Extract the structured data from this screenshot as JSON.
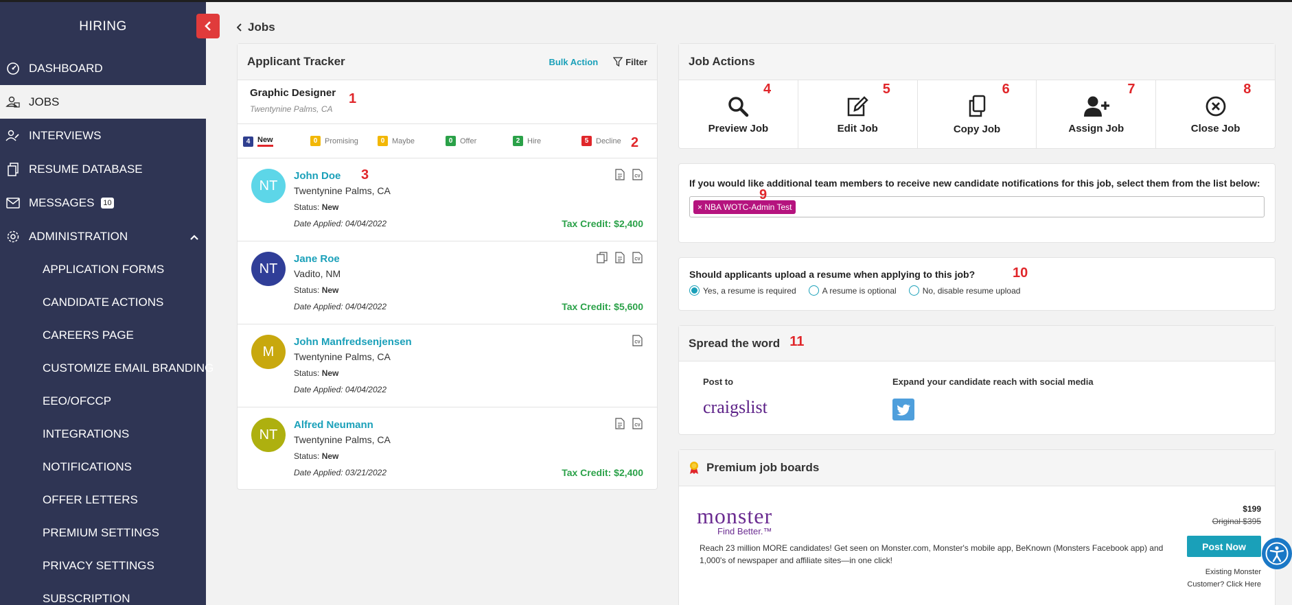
{
  "sidebar": {
    "brand": "HIRING",
    "items": [
      {
        "label": "DASHBOARD",
        "icon": "dashboard-icon"
      },
      {
        "label": "JOBS",
        "icon": "jobs-icon"
      },
      {
        "label": "INTERVIEWS",
        "icon": "interviews-icon"
      },
      {
        "label": "RESUME DATABASE",
        "icon": "resume-icon"
      },
      {
        "label": "MESSAGES",
        "icon": "mail-icon",
        "badge": "10"
      },
      {
        "label": "ADMINISTRATION",
        "icon": "gear-icon"
      }
    ],
    "sub_items": [
      "APPLICATION FORMS",
      "CANDIDATE ACTIONS",
      "CAREERS PAGE",
      "CUSTOMIZE EMAIL BRANDING",
      "EEO/OFCCP",
      "INTEGRATIONS",
      "NOTIFICATIONS",
      "OFFER LETTERS",
      "PREMIUM SETTINGS",
      "PRIVACY SETTINGS",
      "SUBSCRIPTION"
    ]
  },
  "breadcrumb": "Jobs",
  "tracker": {
    "title": "Applicant Tracker",
    "bulk_action": "Bulk Action",
    "filter": "Filter",
    "job_title": "Graphic Designer",
    "job_location": "Twentynine Palms, CA",
    "stages": [
      {
        "count": "4",
        "label": "New",
        "color": "#2f3f8f"
      },
      {
        "count": "0",
        "label": "Promising",
        "color": "#f2b705"
      },
      {
        "count": "0",
        "label": "Maybe",
        "color": "#f2b705"
      },
      {
        "count": "0",
        "label": "Offer",
        "color": "#2aa148"
      },
      {
        "count": "2",
        "label": "Hire",
        "color": "#2aa148"
      },
      {
        "count": "5",
        "label": "Decline",
        "color": "#e0262a"
      }
    ],
    "applicants": [
      {
        "initials": "NT",
        "name": "John Doe",
        "location": "Twentynine Palms, CA",
        "status_label": "Status:",
        "status": "New",
        "date": "Date Applied: 04/04/2022",
        "credit": "Tax Credit: $2,400",
        "avatar_color": "#5dd6e8"
      },
      {
        "initials": "NT",
        "name": "Jane Roe",
        "location": "Vadito, NM",
        "status_label": "Status:",
        "status": "New",
        "date": "Date Applied: 04/04/2022",
        "credit": "Tax Credit: $5,600",
        "avatar_color": "#303e98"
      },
      {
        "initials": "M",
        "name": "John Manfredsenjensen",
        "location": "Twentynine Palms, CA",
        "status_label": "Status:",
        "status": "New",
        "date": "Date Applied: 04/04/2022",
        "credit": "",
        "avatar_color": "#c8a80e"
      },
      {
        "initials": "NT",
        "name": "Alfred Neumann",
        "location": "Twentynine Palms, CA",
        "status_label": "Status:",
        "status": "New",
        "date": "Date Applied: 03/21/2022",
        "credit": "Tax Credit: $2,400",
        "avatar_color": "#aeb00f"
      }
    ]
  },
  "job_actions": {
    "title": "Job Actions",
    "actions": [
      "Preview Job",
      "Edit Job",
      "Copy Job",
      "Assign Job",
      "Close Job"
    ]
  },
  "notify": {
    "question": "If you would like additional team members to receive new candidate notifications for this job, select them from the list below:",
    "tag": "× NBA WOTC-Admin Test"
  },
  "resume": {
    "question": "Should applicants upload a resume when applying to this job?",
    "options": [
      "Yes, a resume is required",
      "A resume is optional",
      "No, disable resume upload"
    ],
    "selected": 0
  },
  "spread": {
    "title": "Spread the word",
    "post_to": "Post to",
    "craigslist": "craigslist",
    "expand": "Expand your candidate reach with social media"
  },
  "premium": {
    "title": "Premium job boards",
    "logo": "monster",
    "tagline": "Find Better.™",
    "description": "Reach 23 million MORE candidates! Get seen on Monster.com, Monster's mobile app, BeKnown (Monsters Facebook app) and 1,000's of newspaper and affiliate sites—in one click!",
    "price": "$199",
    "original_price": "Original $395",
    "post_now": "Post Now",
    "existing_1": "Existing Monster",
    "existing_2": "Customer? Click Here"
  },
  "annotations": [
    "1",
    "2",
    "3",
    "4",
    "5",
    "6",
    "7",
    "8",
    "9",
    "10",
    "11"
  ],
  "colors": {
    "sidebar": "#2f3554",
    "accent": "#1aa0b9",
    "credit": "#2aa148",
    "annotation": "#e0262a"
  }
}
